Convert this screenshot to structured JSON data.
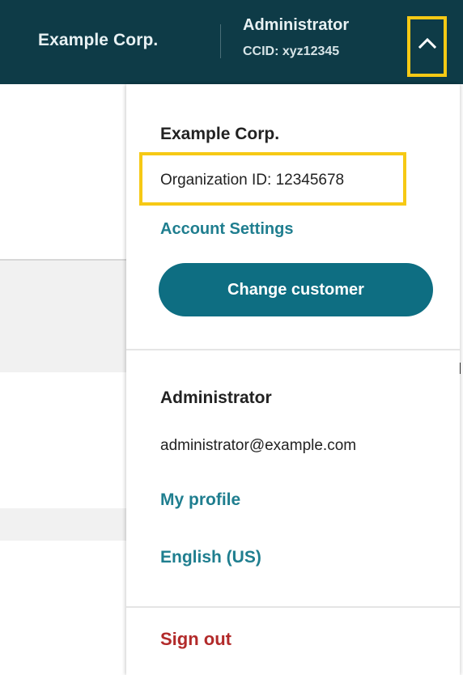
{
  "header": {
    "org_name": "Example Corp.",
    "user_role": "Administrator",
    "ccid": "CCID: xyz12345",
    "toggle_icon": "chevron-up-icon"
  },
  "menu": {
    "org_name": "Example Corp.",
    "org_id": "Organization ID: 12345678",
    "account_settings": "Account Settings",
    "change_customer": "Change customer",
    "user_name": "Administrator",
    "email": "administrator@example.com",
    "my_profile": "My profile",
    "language": "English (US)",
    "sign_out": "Sign out"
  },
  "colors": {
    "header_bg": "#0e3b47",
    "highlight": "#f6c915",
    "link": "#1f7e8f",
    "primary_button": "#0e6e82",
    "danger": "#b22a2a"
  }
}
